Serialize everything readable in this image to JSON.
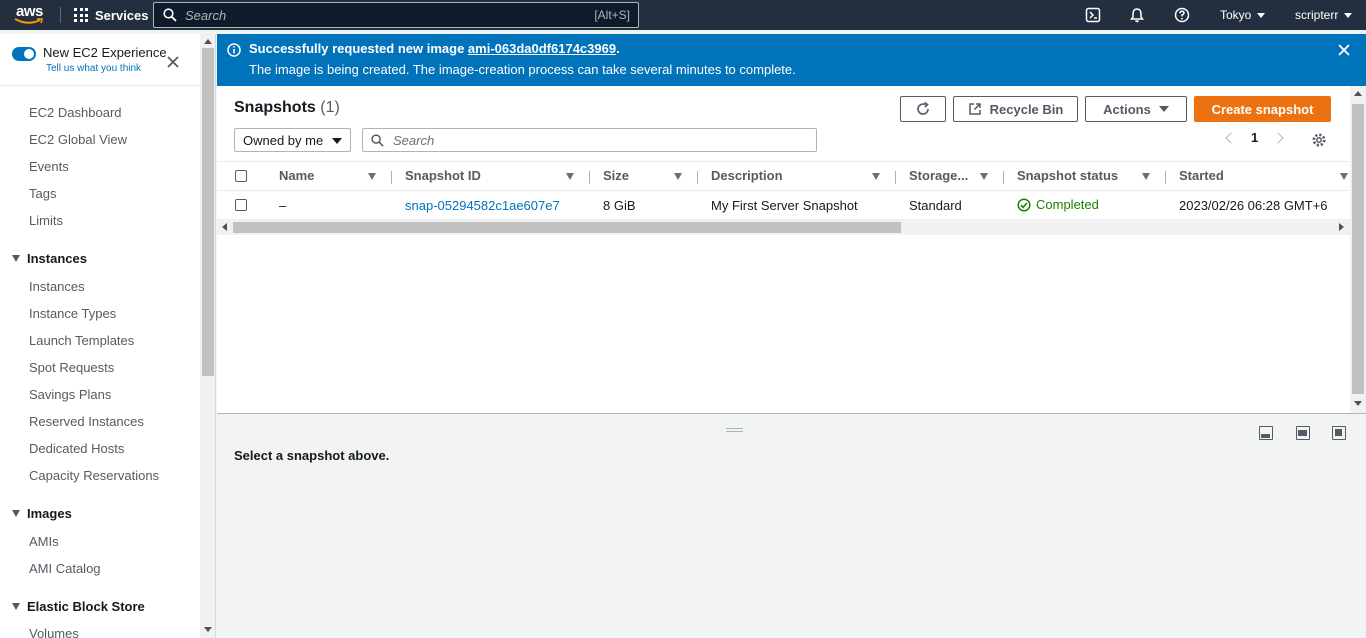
{
  "topnav": {
    "logo_text": "aws",
    "services_label": "Services",
    "search_placeholder": "Search",
    "search_shortcut": "[Alt+S]",
    "region": "Tokyo",
    "user": "scripterr",
    "icons": [
      "cloudshell-icon",
      "bell-icon",
      "help-icon"
    ]
  },
  "sidebar": {
    "toggle_title": "New EC2 Experience",
    "toggle_sub": "Tell us what you think",
    "items": [
      {
        "label": "EC2 Dashboard"
      },
      {
        "label": "EC2 Global View"
      },
      {
        "label": "Events"
      },
      {
        "label": "Tags"
      },
      {
        "label": "Limits"
      }
    ],
    "sections": [
      {
        "title": "Instances",
        "items": [
          "Instances",
          "Instance Types",
          "Launch Templates",
          "Spot Requests",
          "Savings Plans",
          "Reserved Instances",
          "Dedicated Hosts",
          "Capacity Reservations"
        ]
      },
      {
        "title": "Images",
        "items": [
          "AMIs",
          "AMI Catalog"
        ]
      },
      {
        "title": "Elastic Block Store",
        "items": [
          "Volumes"
        ]
      }
    ]
  },
  "banner": {
    "line1_prefix": "Successfully requested new image ",
    "image_id": "ami-063da0df6174c3969",
    "line1_suffix": ".",
    "line2": "The image is being created. The image-creation process can take several minutes to complete."
  },
  "panel": {
    "title": "Snapshots",
    "count": "(1)",
    "recycle_bin": "Recycle Bin",
    "actions": "Actions",
    "create": "Create snapshot",
    "filter_value": "Owned by me",
    "search_placeholder": "Search",
    "page": "1"
  },
  "table": {
    "columns": [
      "Name",
      "Snapshot ID",
      "Size",
      "Description",
      "Storage...",
      "Snapshot status",
      "Started"
    ],
    "rows": [
      {
        "name": "–",
        "snapshot_id": "snap-05294582c1ae607e7",
        "size": "8 GiB",
        "description": "My First Server Snapshot",
        "storage": "Standard",
        "status": "Completed",
        "started": "2023/02/26 06:28 GMT+6"
      }
    ]
  },
  "details": {
    "message": "Select a snapshot above."
  },
  "colors": {
    "nav_bg": "#232f3e",
    "banner_bg": "#0073bb",
    "primary_button": "#ec7211",
    "link": "#0073bb",
    "success": "#1d8102"
  }
}
